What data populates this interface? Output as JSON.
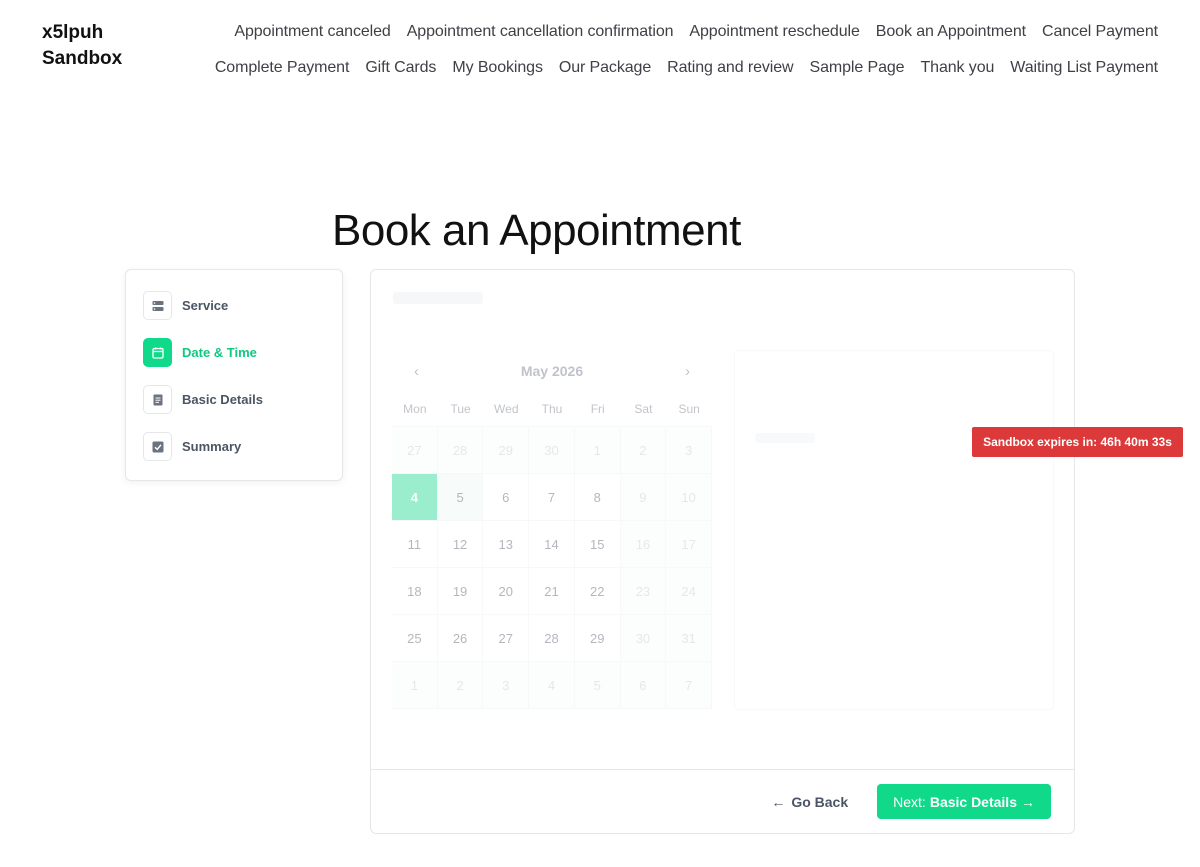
{
  "site": {
    "title": "x5lpuh Sandbox"
  },
  "nav": {
    "row1": [
      "Appointment canceled",
      "Appointment cancellation confirmation",
      "Appointment reschedule",
      "Book an Appointment",
      "Cancel Payment"
    ],
    "row2": [
      "Complete Payment",
      "Gift Cards",
      "My Bookings",
      "Our Package",
      "Rating and review",
      "Sample Page",
      "Thank you",
      "Waiting List Payment"
    ]
  },
  "page": {
    "title": "Book an Appointment"
  },
  "steps": [
    {
      "label": "Service",
      "icon": "server-icon",
      "active": false
    },
    {
      "label": "Date & Time",
      "icon": "calendar-icon",
      "active": true
    },
    {
      "label": "Basic Details",
      "icon": "document-icon",
      "active": false
    },
    {
      "label": "Summary",
      "icon": "check-square-icon",
      "active": false
    }
  ],
  "calendar": {
    "month": "May 2026",
    "weekdays": [
      "Mon",
      "Tue",
      "Wed",
      "Thu",
      "Fri",
      "Sat",
      "Sun"
    ],
    "days": [
      {
        "d": "27",
        "muted": true
      },
      {
        "d": "28",
        "muted": true
      },
      {
        "d": "29",
        "muted": true
      },
      {
        "d": "30",
        "muted": true
      },
      {
        "d": "1",
        "muted": true
      },
      {
        "d": "2",
        "muted": true
      },
      {
        "d": "3",
        "muted": true
      },
      {
        "d": "4",
        "selected": true
      },
      {
        "d": "5",
        "today": true
      },
      {
        "d": "6"
      },
      {
        "d": "7"
      },
      {
        "d": "8"
      },
      {
        "d": "9",
        "muted": true
      },
      {
        "d": "10",
        "muted": true
      },
      {
        "d": "11"
      },
      {
        "d": "12"
      },
      {
        "d": "13"
      },
      {
        "d": "14"
      },
      {
        "d": "15"
      },
      {
        "d": "16",
        "muted": true
      },
      {
        "d": "17",
        "muted": true
      },
      {
        "d": "18"
      },
      {
        "d": "19"
      },
      {
        "d": "20"
      },
      {
        "d": "21"
      },
      {
        "d": "22"
      },
      {
        "d": "23",
        "muted": true
      },
      {
        "d": "24",
        "muted": true
      },
      {
        "d": "25"
      },
      {
        "d": "26"
      },
      {
        "d": "27"
      },
      {
        "d": "28"
      },
      {
        "d": "29"
      },
      {
        "d": "30",
        "muted": true
      },
      {
        "d": "31",
        "muted": true
      },
      {
        "d": "1",
        "muted": true
      },
      {
        "d": "2",
        "muted": true
      },
      {
        "d": "3",
        "muted": true
      },
      {
        "d": "4",
        "muted": true
      },
      {
        "d": "5",
        "muted": true
      },
      {
        "d": "6",
        "muted": true
      },
      {
        "d": "7",
        "muted": true
      }
    ]
  },
  "footer": {
    "go_back_label": "Go Back",
    "next_prefix": "Next:",
    "next_label": "Basic Details"
  },
  "sandbox": {
    "badge": "Sandbox expires in: 46h 40m 33s"
  },
  "colors": {
    "accent": "#10d98a",
    "badge": "#dc3a3a"
  }
}
